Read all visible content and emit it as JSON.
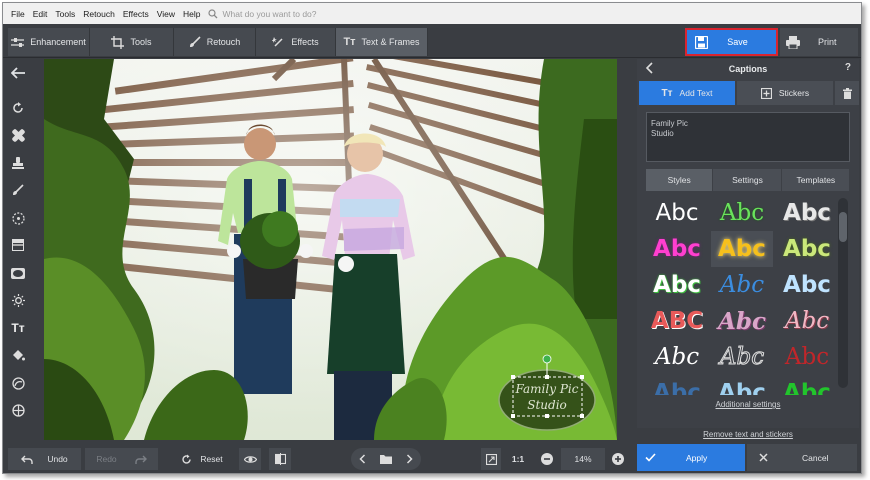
{
  "menu": {
    "items": [
      "File",
      "Edit",
      "Tools",
      "Retouch",
      "Effects",
      "View",
      "Help"
    ],
    "search_placeholder": "What do you want to do?"
  },
  "toolbar": {
    "tabs": [
      "Enhancement",
      "Tools",
      "Retouch",
      "Effects",
      "Text & Frames"
    ],
    "active_tab": "Text & Frames",
    "save_label": "Save",
    "print_label": "Print",
    "accent_color": "#2b7be0",
    "highlight_color": "#d9242f"
  },
  "canvas": {
    "caption_line1": "Family Pic",
    "caption_line2": "Studio"
  },
  "panel": {
    "title": "Captions",
    "help": "?",
    "subtabs": [
      "Add Text",
      "Stickers"
    ],
    "text_value": "Family Pic\nStudio",
    "style_tabs": [
      "Styles",
      "Settings",
      "Templates"
    ],
    "active_style_tab": "Styles",
    "sample_text": "Abc",
    "sample_text_2": "ABC",
    "additional_settings": "Additional settings",
    "remove_text": "Remove text and stickers"
  },
  "bottom": {
    "undo": "Undo",
    "redo": "Redo",
    "reset": "Reset",
    "zoom_ratio": "1:1",
    "zoom_percent": "14%",
    "apply": "Apply",
    "cancel": "Cancel"
  }
}
